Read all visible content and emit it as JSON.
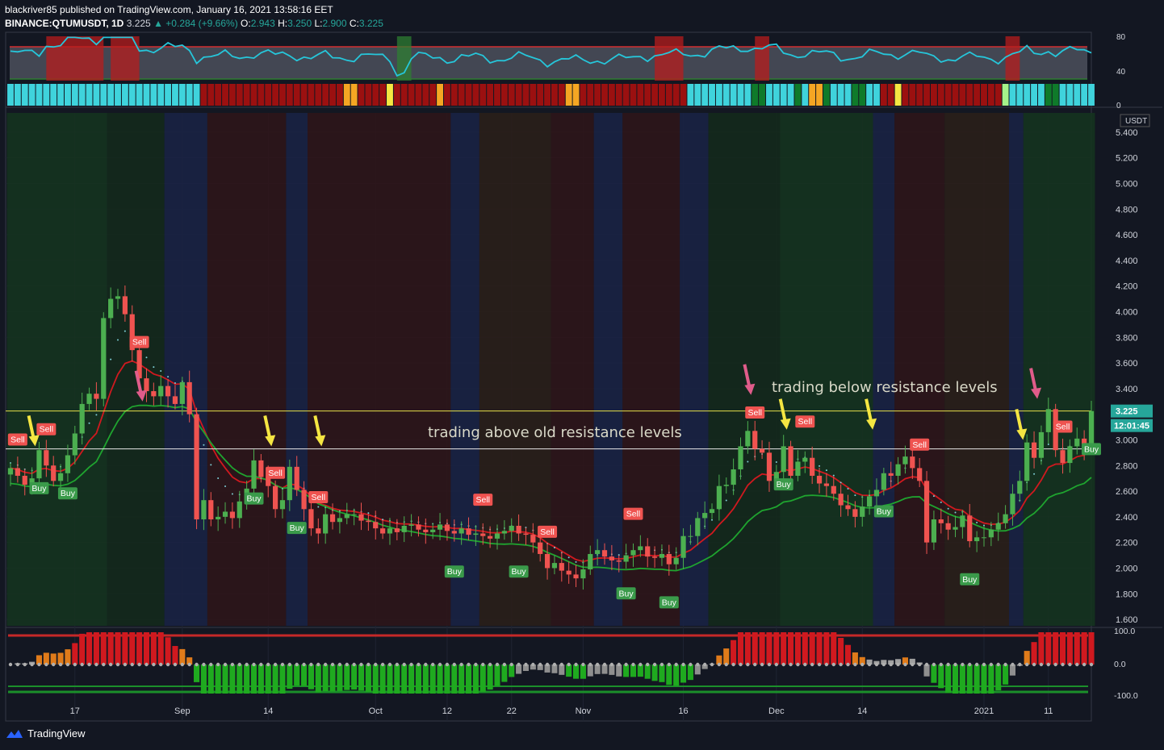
{
  "header": {
    "published_line": "blackriver85 published on TradingView.com, January 16, 2021 13:58:16 EET",
    "symbol": "BINANCE:QTUMUSDT, 1D",
    "price": "3.225",
    "arrow": "▲",
    "change": "+0.284 (+9.66%)",
    "o_label": "O:",
    "o_val": "2.943",
    "h_label": "H:",
    "h_val": "3.250",
    "l_label": "L:",
    "l_val": "2.900",
    "c_label": "C:",
    "c_val": "3.225"
  },
  "branding": {
    "logo_text": "TradingView",
    "logo_icon": "tradingview-cloud-icon"
  },
  "colors": {
    "up": "#26a69a",
    "down": "#ef5350",
    "yellow": "#f5e642",
    "pink": "#e05c8a"
  },
  "chart_data": {
    "type": "candlestick",
    "symbol": "QTUMUSDT",
    "currency_label": "USDT",
    "last_price_label": "3.225",
    "countdown_label": "12:01:45",
    "price_axis_ticks": [
      "5.400",
      "5.200",
      "5.000",
      "4.800",
      "4.600",
      "4.400",
      "4.200",
      "4.000",
      "3.800",
      "3.600",
      "3.400",
      "3.200",
      "3.000",
      "2.800",
      "2.600",
      "2.400",
      "2.200",
      "2.000",
      "1.800",
      "1.600"
    ],
    "ylim": [
      1.55,
      5.55
    ],
    "time_labels": [
      {
        "label": "17",
        "index": 9
      },
      {
        "label": "Sep",
        "index": 24
      },
      {
        "label": "14",
        "index": 36
      },
      {
        "label": "Oct",
        "index": 51
      },
      {
        "label": "12",
        "index": 61
      },
      {
        "label": "22",
        "index": 70
      },
      {
        "label": "Nov",
        "index": 80
      },
      {
        "label": "16",
        "index": 94
      },
      {
        "label": "Dec",
        "index": 107
      },
      {
        "label": "14",
        "index": 119
      },
      {
        "label": "2021",
        "index": 136
      },
      {
        "label": "11",
        "index": 145
      }
    ],
    "close": [
      2.78,
      2.72,
      2.65,
      2.7,
      2.92,
      2.8,
      2.68,
      2.74,
      2.88,
      3.05,
      3.28,
      3.36,
      3.32,
      3.95,
      4.1,
      4.12,
      3.98,
      3.7,
      3.48,
      3.38,
      3.34,
      3.42,
      3.34,
      3.28,
      3.45,
      3.2,
      2.38,
      2.53,
      2.38,
      2.4,
      2.44,
      2.39,
      2.52,
      2.62,
      2.84,
      2.71,
      2.64,
      2.46,
      2.53,
      2.79,
      2.61,
      2.46,
      2.31,
      2.27,
      2.42,
      2.36,
      2.39,
      2.42,
      2.42,
      2.37,
      2.36,
      2.31,
      2.27,
      2.31,
      2.28,
      2.33,
      2.34,
      2.3,
      2.28,
      2.3,
      2.34,
      2.29,
      2.27,
      2.31,
      2.26,
      2.27,
      2.25,
      2.23,
      2.27,
      2.29,
      2.33,
      2.27,
      2.26,
      2.2,
      2.11,
      2.0,
      2.04,
      1.98,
      1.95,
      1.92,
      1.99,
      2.11,
      2.14,
      2.09,
      2.06,
      2.05,
      2.1,
      2.14,
      2.17,
      2.09,
      2.08,
      2.11,
      2.03,
      2.08,
      2.25,
      2.25,
      2.39,
      2.43,
      2.46,
      2.64,
      2.65,
      2.77,
      2.95,
      3.07,
      2.93,
      2.9,
      2.68,
      2.75,
      2.95,
      2.72,
      2.83,
      2.86,
      2.72,
      2.66,
      2.64,
      2.58,
      2.49,
      2.46,
      2.4,
      2.48,
      2.56,
      2.61,
      2.74,
      2.72,
      2.81,
      2.87,
      2.78,
      2.68,
      2.2,
      2.38,
      2.35,
      2.3,
      2.32,
      2.41,
      2.21,
      2.24,
      2.24,
      2.3,
      2.35,
      2.42,
      2.58,
      2.68,
      2.98,
      2.86,
      3.06,
      3.24,
      2.92,
      2.82,
      2.95,
      3.01,
      2.93,
      3.225
    ],
    "candle_count": 152,
    "last_price": 3.225,
    "signals": [
      {
        "type": "Sell",
        "index": 1
      },
      {
        "type": "Sell",
        "index": 5
      },
      {
        "type": "Buy",
        "index": 4
      },
      {
        "type": "Buy",
        "index": 8
      },
      {
        "type": "Sell",
        "index": 18
      },
      {
        "type": "Buy",
        "index": 34
      },
      {
        "type": "Sell",
        "index": 37
      },
      {
        "type": "Buy",
        "index": 40
      },
      {
        "type": "Sell",
        "index": 43
      },
      {
        "type": "Sell",
        "index": 66
      },
      {
        "type": "Buy",
        "index": 62
      },
      {
        "type": "Sell",
        "index": 75
      },
      {
        "type": "Buy",
        "index": 71
      },
      {
        "type": "Sell",
        "index": 87
      },
      {
        "type": "Buy",
        "index": 86
      },
      {
        "type": "Buy",
        "index": 92
      },
      {
        "type": "Sell",
        "index": 104
      },
      {
        "type": "Buy",
        "index": 108
      },
      {
        "type": "Sell",
        "index": 111
      },
      {
        "type": "Buy",
        "index": 122
      },
      {
        "type": "Sell",
        "index": 127
      },
      {
        "type": "Buy",
        "index": 134
      },
      {
        "type": "Sell",
        "index": 147
      },
      {
        "type": "Buy",
        "index": 151
      }
    ],
    "annotations": [
      "trading above old resistance levels",
      "trading  below resistance levels"
    ],
    "horizontal_levels": [
      3.225,
      2.93
    ],
    "rsi_panel": {
      "ticks": [
        "80",
        "40",
        "0"
      ]
    },
    "oscillator_panel": {
      "ticks": [
        "100.0",
        "0.0",
        "-100.0"
      ]
    }
  }
}
